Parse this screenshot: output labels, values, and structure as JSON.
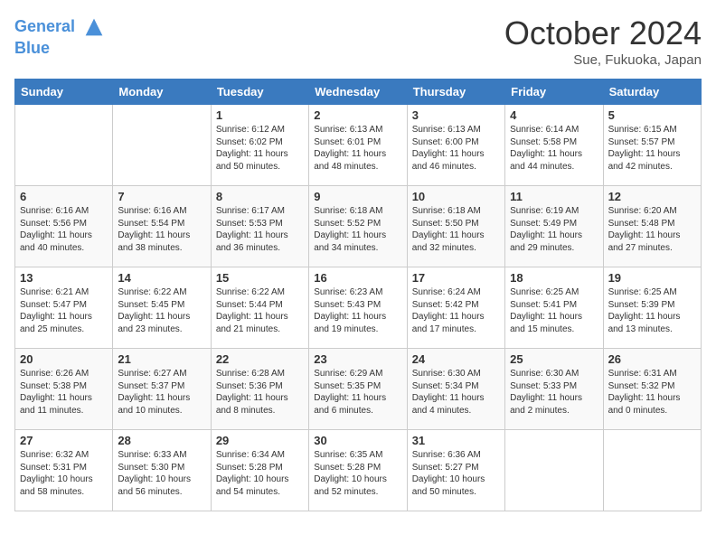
{
  "header": {
    "logo_line1": "General",
    "logo_line2": "Blue",
    "month": "October 2024",
    "location": "Sue, Fukuoka, Japan"
  },
  "weekdays": [
    "Sunday",
    "Monday",
    "Tuesday",
    "Wednesday",
    "Thursday",
    "Friday",
    "Saturday"
  ],
  "weeks": [
    [
      {
        "day": "",
        "info": ""
      },
      {
        "day": "",
        "info": ""
      },
      {
        "day": "1",
        "info": "Sunrise: 6:12 AM\nSunset: 6:02 PM\nDaylight: 11 hours and 50 minutes."
      },
      {
        "day": "2",
        "info": "Sunrise: 6:13 AM\nSunset: 6:01 PM\nDaylight: 11 hours and 48 minutes."
      },
      {
        "day": "3",
        "info": "Sunrise: 6:13 AM\nSunset: 6:00 PM\nDaylight: 11 hours and 46 minutes."
      },
      {
        "day": "4",
        "info": "Sunrise: 6:14 AM\nSunset: 5:58 PM\nDaylight: 11 hours and 44 minutes."
      },
      {
        "day": "5",
        "info": "Sunrise: 6:15 AM\nSunset: 5:57 PM\nDaylight: 11 hours and 42 minutes."
      }
    ],
    [
      {
        "day": "6",
        "info": "Sunrise: 6:16 AM\nSunset: 5:56 PM\nDaylight: 11 hours and 40 minutes."
      },
      {
        "day": "7",
        "info": "Sunrise: 6:16 AM\nSunset: 5:54 PM\nDaylight: 11 hours and 38 minutes."
      },
      {
        "day": "8",
        "info": "Sunrise: 6:17 AM\nSunset: 5:53 PM\nDaylight: 11 hours and 36 minutes."
      },
      {
        "day": "9",
        "info": "Sunrise: 6:18 AM\nSunset: 5:52 PM\nDaylight: 11 hours and 34 minutes."
      },
      {
        "day": "10",
        "info": "Sunrise: 6:18 AM\nSunset: 5:50 PM\nDaylight: 11 hours and 32 minutes."
      },
      {
        "day": "11",
        "info": "Sunrise: 6:19 AM\nSunset: 5:49 PM\nDaylight: 11 hours and 29 minutes."
      },
      {
        "day": "12",
        "info": "Sunrise: 6:20 AM\nSunset: 5:48 PM\nDaylight: 11 hours and 27 minutes."
      }
    ],
    [
      {
        "day": "13",
        "info": "Sunrise: 6:21 AM\nSunset: 5:47 PM\nDaylight: 11 hours and 25 minutes."
      },
      {
        "day": "14",
        "info": "Sunrise: 6:22 AM\nSunset: 5:45 PM\nDaylight: 11 hours and 23 minutes."
      },
      {
        "day": "15",
        "info": "Sunrise: 6:22 AM\nSunset: 5:44 PM\nDaylight: 11 hours and 21 minutes."
      },
      {
        "day": "16",
        "info": "Sunrise: 6:23 AM\nSunset: 5:43 PM\nDaylight: 11 hours and 19 minutes."
      },
      {
        "day": "17",
        "info": "Sunrise: 6:24 AM\nSunset: 5:42 PM\nDaylight: 11 hours and 17 minutes."
      },
      {
        "day": "18",
        "info": "Sunrise: 6:25 AM\nSunset: 5:41 PM\nDaylight: 11 hours and 15 minutes."
      },
      {
        "day": "19",
        "info": "Sunrise: 6:25 AM\nSunset: 5:39 PM\nDaylight: 11 hours and 13 minutes."
      }
    ],
    [
      {
        "day": "20",
        "info": "Sunrise: 6:26 AM\nSunset: 5:38 PM\nDaylight: 11 hours and 11 minutes."
      },
      {
        "day": "21",
        "info": "Sunrise: 6:27 AM\nSunset: 5:37 PM\nDaylight: 11 hours and 10 minutes."
      },
      {
        "day": "22",
        "info": "Sunrise: 6:28 AM\nSunset: 5:36 PM\nDaylight: 11 hours and 8 minutes."
      },
      {
        "day": "23",
        "info": "Sunrise: 6:29 AM\nSunset: 5:35 PM\nDaylight: 11 hours and 6 minutes."
      },
      {
        "day": "24",
        "info": "Sunrise: 6:30 AM\nSunset: 5:34 PM\nDaylight: 11 hours and 4 minutes."
      },
      {
        "day": "25",
        "info": "Sunrise: 6:30 AM\nSunset: 5:33 PM\nDaylight: 11 hours and 2 minutes."
      },
      {
        "day": "26",
        "info": "Sunrise: 6:31 AM\nSunset: 5:32 PM\nDaylight: 11 hours and 0 minutes."
      }
    ],
    [
      {
        "day": "27",
        "info": "Sunrise: 6:32 AM\nSunset: 5:31 PM\nDaylight: 10 hours and 58 minutes."
      },
      {
        "day": "28",
        "info": "Sunrise: 6:33 AM\nSunset: 5:30 PM\nDaylight: 10 hours and 56 minutes."
      },
      {
        "day": "29",
        "info": "Sunrise: 6:34 AM\nSunset: 5:28 PM\nDaylight: 10 hours and 54 minutes."
      },
      {
        "day": "30",
        "info": "Sunrise: 6:35 AM\nSunset: 5:28 PM\nDaylight: 10 hours and 52 minutes."
      },
      {
        "day": "31",
        "info": "Sunrise: 6:36 AM\nSunset: 5:27 PM\nDaylight: 10 hours and 50 minutes."
      },
      {
        "day": "",
        "info": ""
      },
      {
        "day": "",
        "info": ""
      }
    ]
  ]
}
